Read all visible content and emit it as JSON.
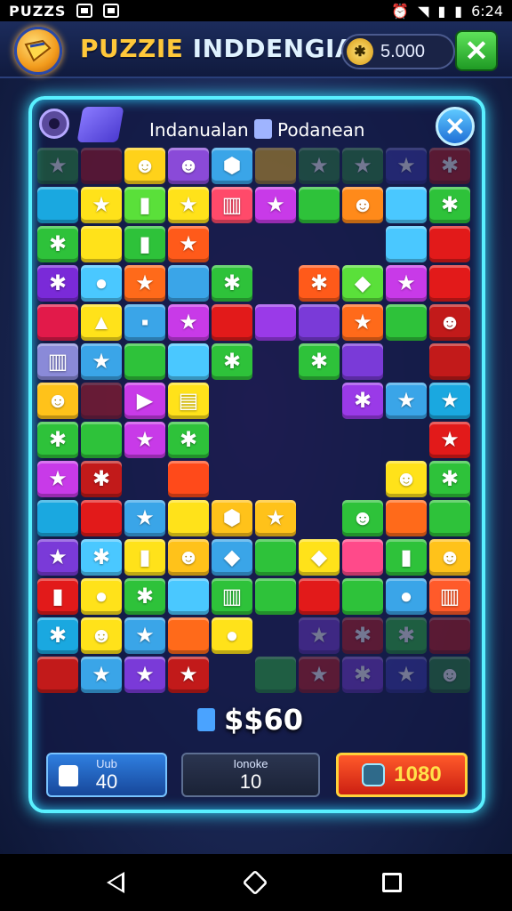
{
  "status_bar": {
    "app_label": "PUZZS",
    "time": "6:24"
  },
  "header": {
    "title_word1": "PUZZIE",
    "title_word2": "INDDENGIAI",
    "coins": "5.000",
    "close_symbol": "✕"
  },
  "board": {
    "label_left": "Indanualan",
    "label_right": "Podanean",
    "close_symbol": "✕",
    "score": "$$60",
    "rows": [
      [
        "#2e9a3a:★:d",
        "#b5121d::d",
        "#ffd21a:☻",
        "#8a4ad8:☻",
        "#3aa5e8:⬢",
        "#ffc21a::d",
        "#2b8a3a:★:d",
        "#2b8a3a:★:d",
        "#3a3ab0:★:d",
        "#c21a1a:✱:d"
      ],
      [
        "#1aa8e0:",
        "#ffe21a:★",
        "#5ae03a:▮",
        "#ffe21a:★",
        "#ff4a6a:▥",
        "#c83ae8:★",
        "#2ec23a:",
        "#ff8a1a:☻",
        "#4ac8ff:",
        "#2ec23a:✱"
      ],
      [
        "#2ec23a:✱",
        "#ffe21a:",
        "#2ec23a:▮",
        "#ff5a1a:★",
        "#2b2b5a::e",
        "#2b2b5a::e",
        "#2b2b5a::e",
        "#2b2b5a::e",
        "#4ac8ff:",
        "#e21a1a:"
      ],
      [
        "#7a2ad8:✱",
        "#4ac8ff:●",
        "#ff6a1a:★",
        "#3aa5e8:",
        "#2ec23a:✱",
        "#2b2b5a::e",
        "#ff5a1a:✱",
        "#5ae03a:◆",
        "#c83ae8:★",
        "#e21a1a:"
      ],
      [
        "#e21a4a:",
        "#ffe21a:▲",
        "#3aa5e8:▪",
        "#c83ae8:★",
        "#e21a1a:",
        "#9a3ae8:",
        "#7a3ad8:",
        "#ff6a1a:★",
        "#2ec23a:",
        "#c21a1a:☻"
      ],
      [
        "#8a8ad8:▥",
        "#3aa5e8:★",
        "#2ec23a:",
        "#4ac8ff:",
        "#2ec23a:✱",
        "#2b2b5a::e",
        "#2ec23a:✱",
        "#7a3ad8:",
        "#2b2b5a::e",
        "#c21a1a:"
      ],
      [
        "#ffc21a:☻",
        "#e21a1a::d",
        "#c83ae8:▶",
        "#ffe21a:▤",
        "#2b2b5a::e",
        "#2b2b5a::e",
        "#2b2b5a::e",
        "#9a3ae8:✱",
        "#3aa5e8:★",
        "#1aa8e0:★"
      ],
      [
        "#2ec23a:✱",
        "#2ec23a:",
        "#c83ae8:★",
        "#2ec23a:✱",
        "#2b2b5a::e",
        "#2b2b5a::e",
        "#2b2b5a::e",
        "#2b2b5a::e",
        "#2b2b5a::e",
        "#e21a1a:★"
      ],
      [
        "#c83ae8:★",
        "#c21a1a:✱",
        "#2b2b5a::e",
        "#ff4a1a:",
        "#2b2b5a::e",
        "#2b2b5a::e",
        "#2b2b5a::e",
        "#2b2b5a::e",
        "#ffe21a:☻",
        "#2ec23a:✱"
      ],
      [
        "#1aa8e0:",
        "#e21a1a:",
        "#3aa5e8:★",
        "#ffe21a:",
        "#ffc21a:⬢",
        "#ffc21a:★",
        "#2b2b5a::e",
        "#2ec23a:☻",
        "#ff6a1a:",
        "#2ec23a:"
      ],
      [
        "#7a3ad8:★",
        "#4ac8ff:✱",
        "#ffe21a:▮",
        "#ffc21a:☻",
        "#3aa5e8:◆",
        "#2ec23a:",
        "#ffe21a:◆",
        "#ff4a8a:",
        "#2ec23a:▮",
        "#ffc21a:☻"
      ],
      [
        "#e21a1a:▮",
        "#ffe21a:●",
        "#2ec23a:✱",
        "#4ac8ff:",
        "#2ec23a:▥",
        "#2ec23a:",
        "#e21a1a:",
        "#2ec23a:",
        "#3aa5e8:●",
        "#ff5a2a:▥"
      ],
      [
        "#1aa8e0:✱",
        "#ffe21a:☻",
        "#3aa5e8:★",
        "#ff6a1a:",
        "#ffe21a:●",
        "#2b2b5a::e",
        "#7a3ad8:★:d",
        "#c21a1a:✱:d",
        "#2ec23a:✱:d",
        "#c21a1a::d"
      ],
      [
        "#c21a1a:",
        "#3aa5e8:★",
        "#7a3ad8:★",
        "#c21a1a:★",
        "#2b2b5a::e",
        "#2ec23a::d",
        "#c21a1a:★:d",
        "#7a3ad8:✱:d",
        "#3a3ab0:★:d",
        "#2b8a3a:☻:d"
      ]
    ]
  },
  "buttons": {
    "left": {
      "label": "Uub",
      "value": "40"
    },
    "middle": {
      "label": "Ionoke",
      "value": "10"
    },
    "right": {
      "value": "1080"
    }
  },
  "colors": {
    "panel_glow": "#59f0ff",
    "title_yellow": "#ffc83a",
    "accent_red": "#cc1f12"
  }
}
